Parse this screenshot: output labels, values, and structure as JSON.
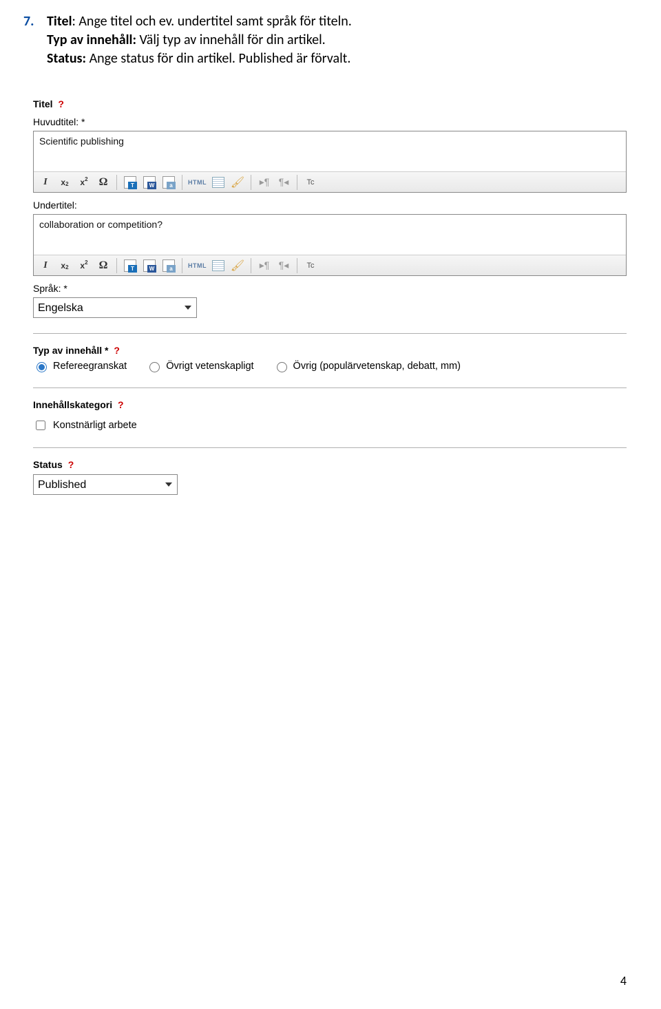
{
  "instruction": {
    "number": "7.",
    "line1_label": "Titel",
    "line1_text": ": Ange titel och ev. undertitel samt språk för titeln.",
    "line2_label": "Typ av innehåll:",
    "line2_text": " Välj typ av innehåll för din artikel.",
    "line3_label": "Status:",
    "line3_text": " Ange status för din artikel. Published är förvalt."
  },
  "section_titel": {
    "heading": "Titel",
    "qmark": "?",
    "field1_label": "Huvudtitel: *",
    "field1_value": "Scientific publishing",
    "field2_label": "Undertitel:",
    "field2_value": "collaboration or competition?",
    "field3_label": "Språk: *",
    "field3_value": "Engelska"
  },
  "section_typ": {
    "heading": "Typ av innehåll *",
    "qmark": "?",
    "opt1": "Refereegranskat",
    "opt2": "Övrigt vetenskapligt",
    "opt3": "Övrig (populärvetenskap, debatt, mm)"
  },
  "section_kategori": {
    "heading": "Innehållskategori",
    "qmark": "?",
    "opt1": "Konstnärligt arbete"
  },
  "section_status": {
    "heading": "Status",
    "qmark": "?",
    "value": "Published"
  },
  "toolbar": {
    "italic": "I",
    "sub_x": "x",
    "sub_s": "2",
    "sup_x": "x",
    "sup_s": "2",
    "omega": "Ω",
    "doc_t": "T",
    "doc_w": "W",
    "doc_a": "a",
    "html": "HTML",
    "tc": "Tc",
    "para1": "▸¶",
    "para2": "¶◂"
  },
  "page_number": "4"
}
